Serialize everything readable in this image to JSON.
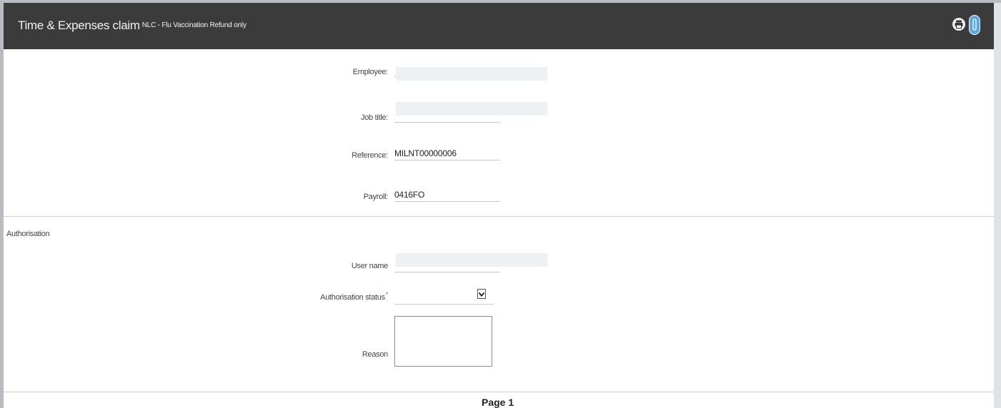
{
  "header": {
    "title": "Time & Expenses claim",
    "subtitle": "NLC - Flu Vaccination Refund only"
  },
  "icons": {
    "print": "print-icon",
    "attach": "attachment-icon"
  },
  "fields": {
    "employee": {
      "label": "Employee:",
      "value": ""
    },
    "job_title": {
      "label": "Job title:",
      "value": ""
    },
    "reference": {
      "label": "Reference:",
      "value": "MILNT00000006"
    },
    "payroll": {
      "label": "Payroll:",
      "value": "0416FO"
    }
  },
  "authorisation": {
    "section_label": "Authorisation",
    "user_name_label": "User name",
    "user_name_value": "",
    "status_label": "Authorisation status",
    "status_required_mark": "*",
    "status_value": "",
    "reason_label": "Reason",
    "reason_value": ""
  },
  "footer": {
    "page_label": "Page 1"
  },
  "colors": {
    "header_bg": "#3b3b3b",
    "required_mark": "#3f8ee0",
    "attach_icon": "#5aa8e8"
  }
}
